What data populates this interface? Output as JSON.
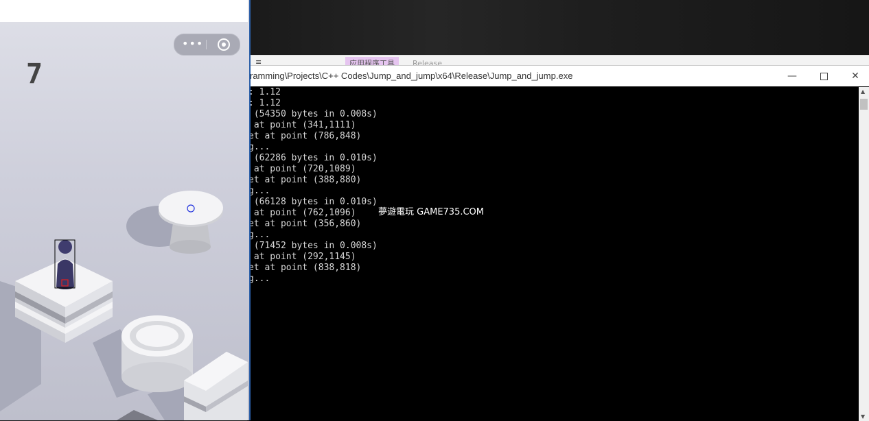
{
  "game": {
    "score": "7",
    "menu_icon": "more-dots-icon",
    "close_icon": "target-icon"
  },
  "ribbon": {
    "menu_glyph": "≡",
    "tab_tools": "应用程序工具",
    "tab_release": "Release"
  },
  "console": {
    "title": "ramming\\Projects\\C++ Codes\\Jump_and_jump\\x64\\Release\\Jump_and_jump.exe",
    "buttons": {
      "minimize": "—",
      "close": "✕"
    },
    "lines": [
      ": 1.12",
      ": 1.12",
      " (54350 bytes in 0.008s)",
      " at point (341,1111)",
      "et at point (786,848)",
      "g...",
      " (62286 bytes in 0.010s)",
      " at point (720,1089)",
      "et at point (388,880)",
      "g...",
      " (66128 bytes in 0.010s)",
      " at point (762,1096)",
      "et at point (356,860)",
      "g...",
      " (71452 bytes in 0.008s)",
      " at point (292,1145)",
      "et at point (838,818)",
      "g..."
    ]
  },
  "watermark": "夢遊電玩 GAME735.COM",
  "colors": {
    "console_bg": "#000000",
    "console_text": "#d8d8d8",
    "game_bg": "#d3d4df",
    "piece": "#3a3765",
    "selection_box": "#000000",
    "target_marker": "#2233dd",
    "player_marker": "#e02020"
  }
}
